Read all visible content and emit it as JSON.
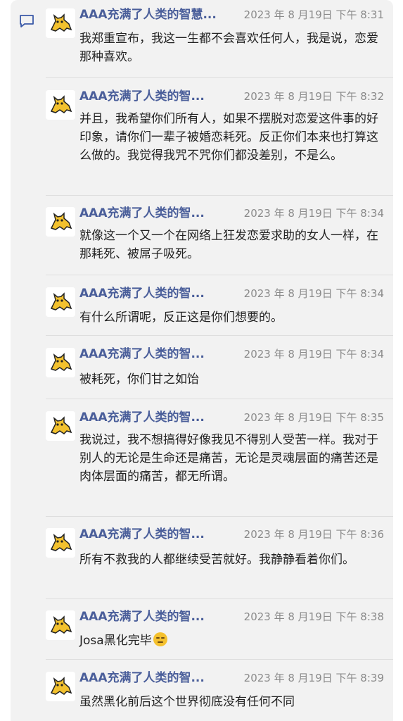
{
  "icons": {
    "comment": "comment-bubble-icon",
    "avatar": "yellow-cat-avatar-icon"
  },
  "colors": {
    "sender": "#4a5e9a",
    "panel": "#f2f2f2",
    "accent_icon": "#3b5aa8"
  },
  "messages": [
    {
      "sender": "AAA充满了人类的智慧...",
      "time": "2023 年 8 月19日 下午 8:31",
      "text": "我郑重宣布，我这一生都不会喜欢任何人，我是说，恋爱那种喜欢。"
    },
    {
      "sender": "AAA充满了人类的智...",
      "time": "2023 年 8 月19日 下午 8:32",
      "text": "并且，我希望你们所有人，如果不摆脱对恋爱这件事的好印象，请你们一辈子被婚恋耗死。反正你们本来也打算这么做的。我觉得我咒不咒你们都没差别，不是么。"
    },
    {
      "sender": "AAA充满了人类的智...",
      "time": "2023 年 8 月19日 下午 8:34",
      "text": "就像这一个又一个在网络上狂发恋爱求助的女人一样，在那耗死、被屌子吸死。"
    },
    {
      "sender": "AAA充满了人类的智...",
      "time": "2023 年 8 月19日 下午 8:34",
      "text": "有什么所谓呢，反正这是你们想要的。"
    },
    {
      "sender": "AAA充满了人类的智...",
      "time": "2023 年 8 月19日 下午 8:34",
      "text": "被耗死，你们甘之如饴"
    },
    {
      "sender": "AAA充满了人类的智...",
      "time": "2023 年 8 月19日 下午 8:35",
      "text": "我说过，我不想搞得好像我见不得别人受苦一样。我对于别人的无论是生命还是痛苦，无论是灵魂层面的痛苦还是肉体层面的痛苦，都无所谓。"
    },
    {
      "sender": "AAA充满了人类的智...",
      "time": "2023 年 8 月19日 下午 8:36",
      "text": "所有不救我的人都继续受苦就好。我静静看着你们。"
    },
    {
      "sender": "AAA充满了人类的智...",
      "time": "2023 年 8 月19日 下午 8:38",
      "text": "Josa黑化完毕",
      "emoji": "expressionless-face-emoji"
    },
    {
      "sender": "AAA充满了人类的智...",
      "time": "2023 年 8 月19日 下午 8:39",
      "text": "虽然黑化前后这个世界彻底没有任何不同"
    }
  ]
}
